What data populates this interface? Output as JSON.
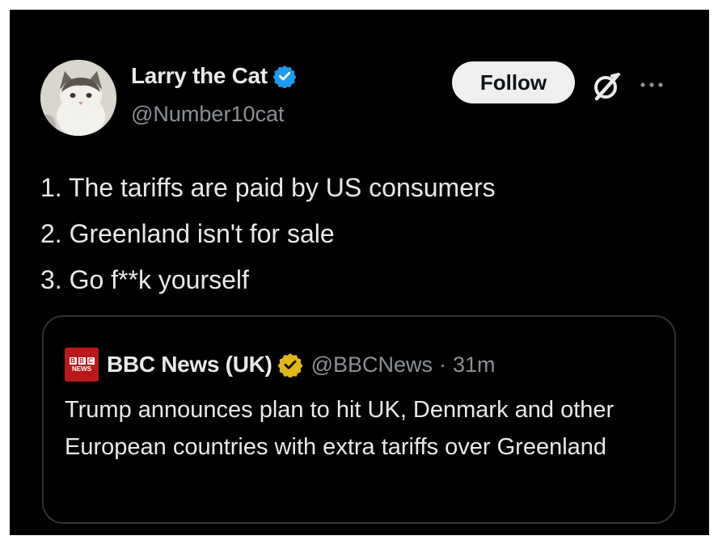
{
  "tweet": {
    "author": {
      "name": "Larry the Cat",
      "handle": "@Number10cat",
      "avatar_icon": "cat-avatar",
      "verified_icon": "verified-badge-icon"
    },
    "follow_label": "Follow",
    "lines": [
      "1. The tariffs are paid by US consumers",
      "2. Greenland isn't for sale",
      "3. Go f**k yourself"
    ]
  },
  "quote": {
    "name": "BBC News (UK)",
    "handle": "@BBCNews",
    "separator": "·",
    "time": "31m",
    "logo_icon": "bbc-news-logo",
    "verified_icon": "gold-verified-badge-icon",
    "text": "Trump announces plan to hit UK, Denmark and other European countries with extra tariffs over Greenland"
  },
  "colors": {
    "background": "#000000",
    "text": "#e9e9e9",
    "secondary": "#8b9096",
    "verified_blue": "#1d9bf0",
    "verified_gold": "#e2b719",
    "bbc_red": "#bb1919"
  }
}
